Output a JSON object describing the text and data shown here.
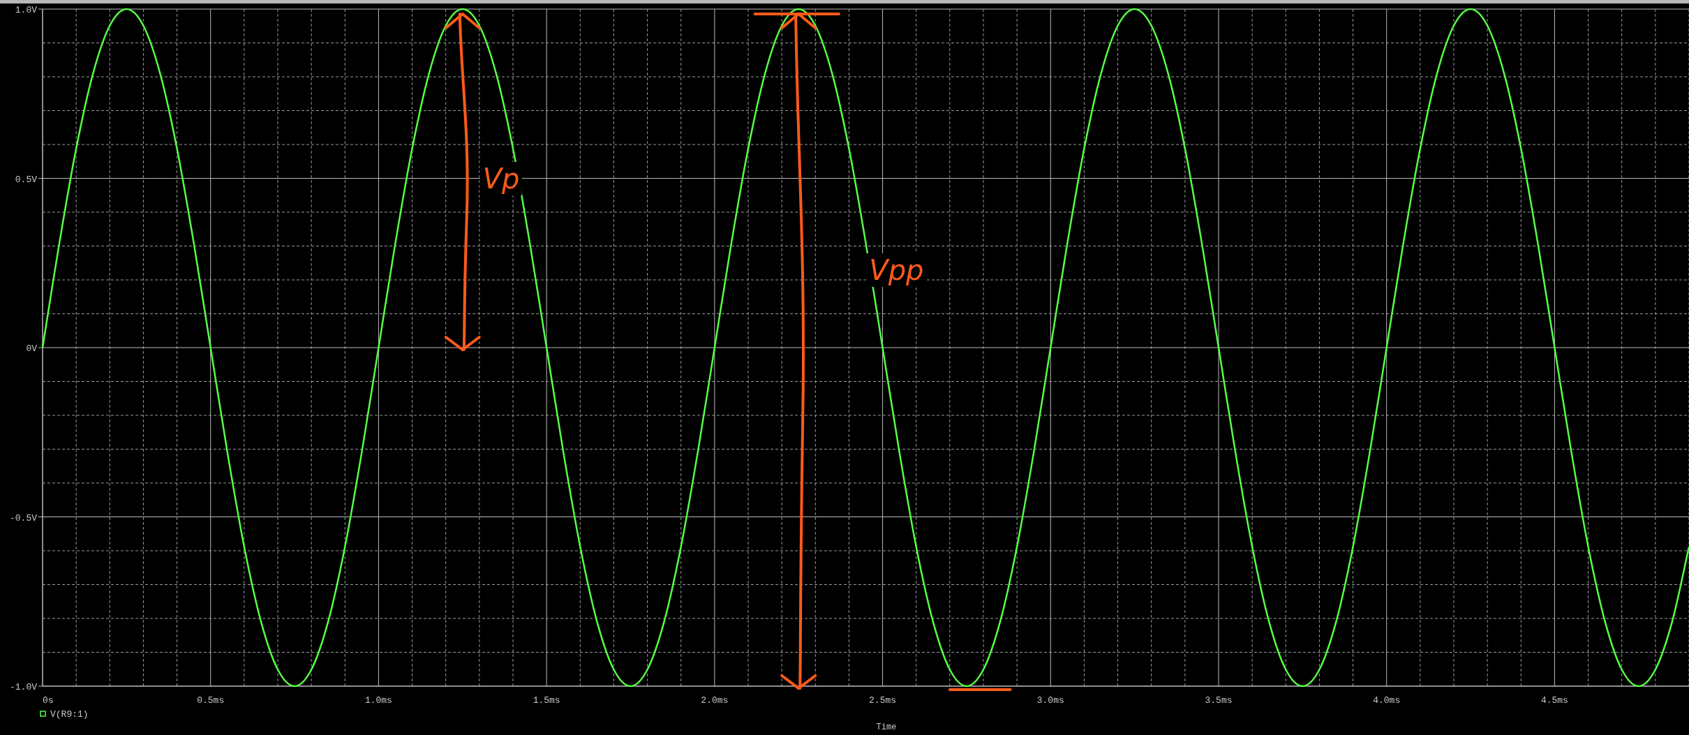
{
  "plot": {
    "chart_data": {
      "type": "line",
      "xlabel": "Time",
      "xlim": [
        0,
        4.9
      ],
      "ylim": [
        -1,
        1
      ],
      "x": [
        0,
        0.05,
        0.1,
        0.15,
        0.2,
        0.25,
        0.3,
        0.35,
        0.4,
        0.45,
        0.5,
        0.55,
        0.6,
        0.65,
        0.7,
        0.75,
        0.8,
        0.85,
        0.9,
        0.95,
        1,
        1.05,
        1.1,
        1.15,
        1.2,
        1.25,
        1.3,
        1.35,
        1.4,
        1.45,
        1.5,
        1.55,
        1.6,
        1.65,
        1.7,
        1.75,
        1.8,
        1.85,
        1.9,
        1.95,
        2,
        2.05,
        2.1,
        2.15,
        2.2,
        2.25,
        2.3,
        2.35,
        2.4,
        2.45,
        2.5,
        2.55,
        2.6,
        2.65,
        2.7,
        2.75,
        2.8,
        2.85,
        2.9,
        2.95,
        3,
        3.05,
        3.1,
        3.15,
        3.2,
        3.25,
        3.3,
        3.35,
        3.4,
        3.45,
        3.5,
        3.55,
        3.6,
        3.65,
        3.7,
        3.75,
        3.8,
        3.85,
        3.9,
        3.95,
        4,
        4.05,
        4.1,
        4.15,
        4.2,
        4.25,
        4.3,
        4.35,
        4.4,
        4.45,
        4.5,
        4.55,
        4.6,
        4.65,
        4.7,
        4.75,
        4.8,
        4.85,
        4.9
      ],
      "series": [
        {
          "name": "V(R9:1)",
          "color": "#55ff44",
          "values": [
            0,
            0.309,
            0.588,
            0.809,
            0.951,
            1,
            0.951,
            0.809,
            0.588,
            0.309,
            0,
            -0.309,
            -0.588,
            -0.809,
            -0.951,
            -1,
            -0.951,
            -0.809,
            -0.588,
            -0.309,
            0,
            0.309,
            0.588,
            0.809,
            0.951,
            1,
            0.951,
            0.809,
            0.588,
            0.309,
            0,
            -0.309,
            -0.588,
            -0.809,
            -0.951,
            -1,
            -0.951,
            -0.809,
            -0.588,
            -0.309,
            0,
            0.309,
            0.588,
            0.809,
            0.951,
            1,
            0.951,
            0.809,
            0.588,
            0.309,
            0,
            -0.309,
            -0.588,
            -0.809,
            -0.951,
            -1,
            -0.951,
            -0.809,
            -0.588,
            -0.309,
            0,
            0.309,
            0.588,
            0.809,
            0.951,
            1,
            0.951,
            0.809,
            0.588,
            0.309,
            0,
            -0.309,
            -0.588,
            -0.809,
            -0.951,
            -1,
            -0.951,
            -0.809,
            -0.588,
            -0.309,
            0,
            0.309,
            0.588,
            0.809,
            0.951,
            1,
            0.951,
            0.809,
            0.588,
            0.309,
            0,
            -0.309,
            -0.588,
            -0.809,
            -0.951,
            -1,
            -0.951,
            -0.809,
            -0.588
          ]
        }
      ],
      "xticks": [
        {
          "value": 0,
          "label": "0s"
        },
        {
          "value": 0.5,
          "label": "0.5ms"
        },
        {
          "value": 1,
          "label": "1.0ms"
        },
        {
          "value": 1.5,
          "label": "1.5ms"
        },
        {
          "value": 2,
          "label": "2.0ms"
        },
        {
          "value": 2.5,
          "label": "2.5ms"
        },
        {
          "value": 3,
          "label": "3.0ms"
        },
        {
          "value": 3.5,
          "label": "3.5ms"
        },
        {
          "value": 4,
          "label": "4.0ms"
        },
        {
          "value": 4.5,
          "label": "4.5ms"
        }
      ],
      "yticks": [
        {
          "value": -1,
          "label": "-1.0V"
        },
        {
          "value": -0.5,
          "label": "-0.5V"
        },
        {
          "value": 0,
          "label": "0V"
        },
        {
          "value": 0.5,
          "label": "0.5V"
        },
        {
          "value": 1,
          "label": "1.0V"
        }
      ],
      "grid": true,
      "annotations": [
        "Vp",
        "Vpp"
      ]
    }
  }
}
